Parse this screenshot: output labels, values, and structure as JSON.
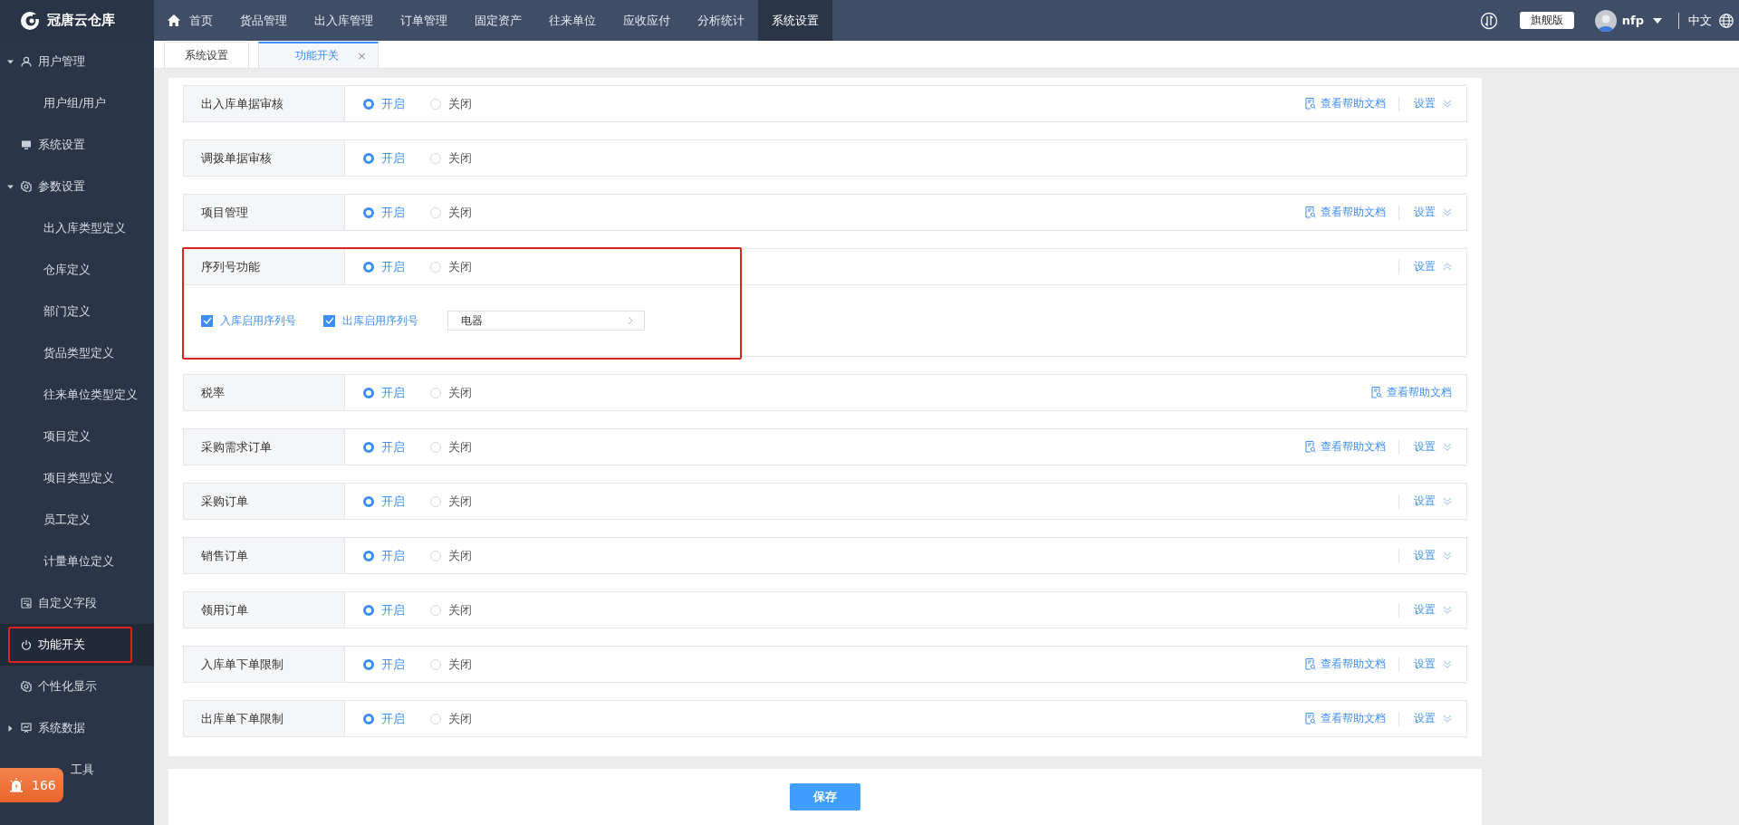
{
  "brand": "冠唐云仓库",
  "nav": [
    {
      "label": "首页",
      "kind": "home",
      "selected": false
    },
    {
      "label": "货品管理",
      "kind": "text",
      "selected": false
    },
    {
      "label": "出入库管理",
      "kind": "text",
      "selected": false
    },
    {
      "label": "订单管理",
      "kind": "text",
      "selected": false
    },
    {
      "label": "固定资产",
      "kind": "text",
      "selected": false
    },
    {
      "label": "往来单位",
      "kind": "text",
      "selected": false
    },
    {
      "label": "应收应付",
      "kind": "text",
      "selected": false
    },
    {
      "label": "分析统计",
      "kind": "text",
      "selected": false
    },
    {
      "label": "系统设置",
      "kind": "text",
      "selected": true
    }
  ],
  "header": {
    "edition": "旗舰版",
    "user": "nfp",
    "language": "中文"
  },
  "tabs": [
    {
      "label": "系统设置",
      "selected": false
    },
    {
      "label": "功能开关",
      "selected": true,
      "close": "×"
    }
  ],
  "sidebar": [
    {
      "label": "用户管理",
      "kind": "user",
      "expanded": true,
      "selected": false,
      "highlighted": false,
      "children": [
        {
          "label": "用户组/用户",
          "selected": false
        }
      ]
    },
    {
      "label": "系统设置",
      "kind": "monitor",
      "selected": false,
      "highlighted": false
    },
    {
      "label": "参数设置",
      "kind": "gear",
      "expanded": true,
      "selected": false,
      "highlighted": false,
      "children": [
        {
          "label": "出入库类型定义",
          "selected": false
        },
        {
          "label": "仓库定义",
          "selected": false
        },
        {
          "label": "部门定义",
          "selected": false
        },
        {
          "label": "货品类型定义",
          "selected": false
        },
        {
          "label": "往来单位类型定义",
          "selected": false
        },
        {
          "label": "项目定义",
          "selected": false
        },
        {
          "label": "项目类型定义",
          "selected": false
        },
        {
          "label": "员工定义",
          "selected": false
        },
        {
          "label": "计量单位定义",
          "selected": false
        }
      ]
    },
    {
      "label": "自定义字段",
      "kind": "form",
      "selected": false,
      "highlighted": false
    },
    {
      "label": "功能开关",
      "kind": "power",
      "selected": true,
      "highlighted": true
    },
    {
      "label": "个性化显示",
      "kind": "gear",
      "selected": false,
      "highlighted": false
    },
    {
      "label": "系统数据",
      "kind": "chart",
      "expanded": false,
      "selected": false,
      "highlighted": false
    },
    {
      "label": "工具",
      "kind": "covered",
      "selected": false,
      "highlighted": false
    }
  ],
  "badge": {
    "count": "166"
  },
  "rows": [
    {
      "label": "出入库单据审核",
      "options": [
        {
          "label": "开启",
          "selected": true
        },
        {
          "label": "关闭",
          "selected": false
        }
      ],
      "help": "查看帮助文档",
      "settings": "设置",
      "expanded": false,
      "highlighted": false
    },
    {
      "label": "调拨单据审核",
      "options": [
        {
          "label": "开启",
          "selected": true
        },
        {
          "label": "关闭",
          "selected": false
        }
      ],
      "highlighted": false
    },
    {
      "label": "项目管理",
      "options": [
        {
          "label": "开启",
          "selected": true
        },
        {
          "label": "关闭",
          "selected": false
        }
      ],
      "help": "查看帮助文档",
      "settings": "设置",
      "expanded": false,
      "highlighted": false
    },
    {
      "label": "序列号功能",
      "options": [
        {
          "label": "开启",
          "selected": true
        },
        {
          "label": "关闭",
          "selected": false
        }
      ],
      "settings": "设置",
      "expanded": true,
      "highlighted": true,
      "details": {
        "checks": [
          {
            "label": "入库启用序列号",
            "checked": true
          },
          {
            "label": "出库启用序列号",
            "checked": true
          }
        ],
        "category": "电器"
      }
    },
    {
      "label": "税率",
      "options": [
        {
          "label": "开启",
          "selected": true
        },
        {
          "label": "关闭",
          "selected": false
        }
      ],
      "help": "查看帮助文档",
      "highlighted": false
    },
    {
      "label": "采购需求订单",
      "options": [
        {
          "label": "开启",
          "selected": true
        },
        {
          "label": "关闭",
          "selected": false
        }
      ],
      "help": "查看帮助文档",
      "settings": "设置",
      "expanded": false,
      "highlighted": false
    },
    {
      "label": "采购订单",
      "options": [
        {
          "label": "开启",
          "selected": true
        },
        {
          "label": "关闭",
          "selected": false
        }
      ],
      "settings": "设置",
      "expanded": false,
      "highlighted": false
    },
    {
      "label": "销售订单",
      "options": [
        {
          "label": "开启",
          "selected": true
        },
        {
          "label": "关闭",
          "selected": false
        }
      ],
      "settings": "设置",
      "expanded": false,
      "highlighted": false
    },
    {
      "label": "领用订单",
      "options": [
        {
          "label": "开启",
          "selected": true
        },
        {
          "label": "关闭",
          "selected": false
        }
      ],
      "settings": "设置",
      "expanded": false,
      "highlighted": false
    },
    {
      "label": "入库单下单限制",
      "options": [
        {
          "label": "开启",
          "selected": true
        },
        {
          "label": "关闭",
          "selected": false
        }
      ],
      "help": "查看帮助文档",
      "settings": "设置",
      "expanded": false,
      "highlighted": false
    },
    {
      "label": "出库单下单限制",
      "options": [
        {
          "label": "开启",
          "selected": true
        },
        {
          "label": "关闭",
          "selected": false
        }
      ],
      "help": "查看帮助文档",
      "settings": "设置",
      "expanded": false,
      "highlighted": false
    }
  ],
  "save": "保存"
}
